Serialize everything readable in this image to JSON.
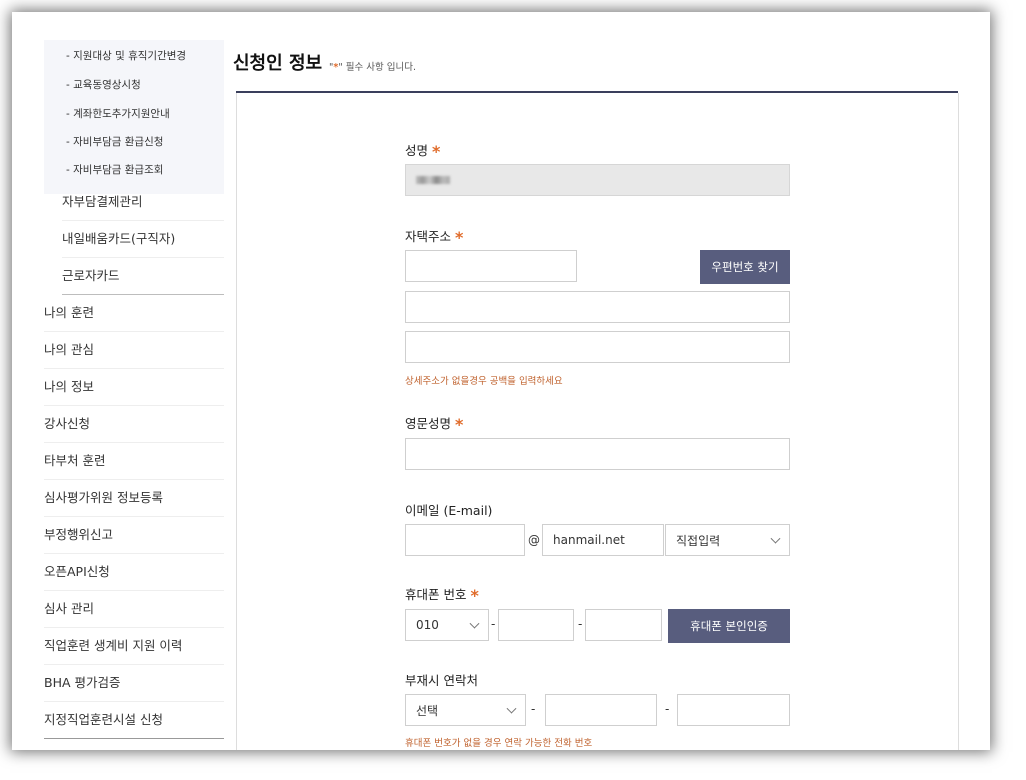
{
  "sidebar": {
    "sub_items": [
      "- 지원대상 및 휴직기간변경",
      "- 교육동영상시청",
      "- 계좌한도추가지원안내",
      "- 자비부담금 환급신청",
      "- 자비부담금 환급조회"
    ],
    "level2_items": [
      "자부담결제관리",
      "내일배움카드(구직자)",
      "근로자카드"
    ],
    "level1_items": [
      "나의 훈련",
      "나의 관심",
      "나의 정보",
      "강사신청",
      "타부처 훈련",
      "심사평가위원 정보등록",
      "부정행위신고",
      "오픈API신청",
      "심사 관리",
      "직업훈련 생계비 지원 이력",
      "BHA 평가검증",
      "지정직업훈련시설 신청"
    ]
  },
  "header": {
    "title": "신청인 정보",
    "required_note_prefix": "\"",
    "required_star": "*",
    "required_note_suffix": "\" 필수 사항 입니다."
  },
  "form": {
    "star": "*",
    "name": {
      "label": "성명"
    },
    "address": {
      "label": "자택주소",
      "zip_button": "우편번호 찾기",
      "hint": "상세주소가 없을경우 공백을 입력하세요"
    },
    "english_name": {
      "label": "영문성명"
    },
    "email": {
      "label": "이메일 (E-mail)",
      "at": "@",
      "domain_value": "hanmail.net",
      "domain_select": "직접입력"
    },
    "mobile": {
      "label": "휴대폰 번호",
      "prefix_select": "010",
      "dash": "-",
      "verify_button": "휴대폰 본인인증"
    },
    "alt_phone": {
      "label": "부재시 연락처",
      "prefix_select": "선택",
      "dash": "-",
      "hint": "휴대폰 번호가 없을 경우 연락 가능한 전화 번호"
    }
  },
  "colors": {
    "accent_button": "#585d7e",
    "required_star": "#e06b2a",
    "hint_text": "#c0622e"
  }
}
